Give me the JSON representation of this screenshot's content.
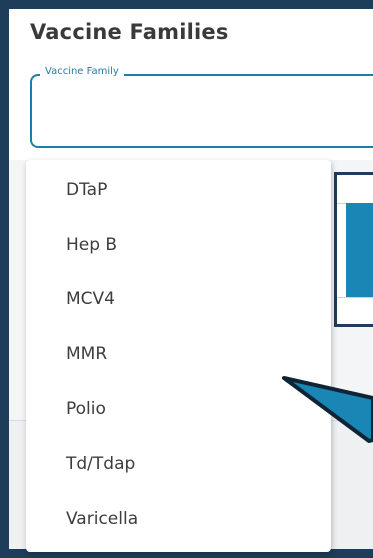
{
  "panel": {
    "title": "Vaccine Families"
  },
  "field": {
    "label": "Vaccine Family",
    "value": ""
  },
  "dropdown": {
    "options": [
      {
        "label": "DTaP"
      },
      {
        "label": "Hep B"
      },
      {
        "label": "MCV4"
      },
      {
        "label": "MMR"
      },
      {
        "label": "Polio"
      },
      {
        "label": "Td/Tdap"
      },
      {
        "label": "Varicella"
      }
    ]
  },
  "colors": {
    "frame": "#1e3d5a",
    "accent": "#1f7ea8",
    "text": "#3d3d3d",
    "callout_fill": "#1a86b5"
  }
}
